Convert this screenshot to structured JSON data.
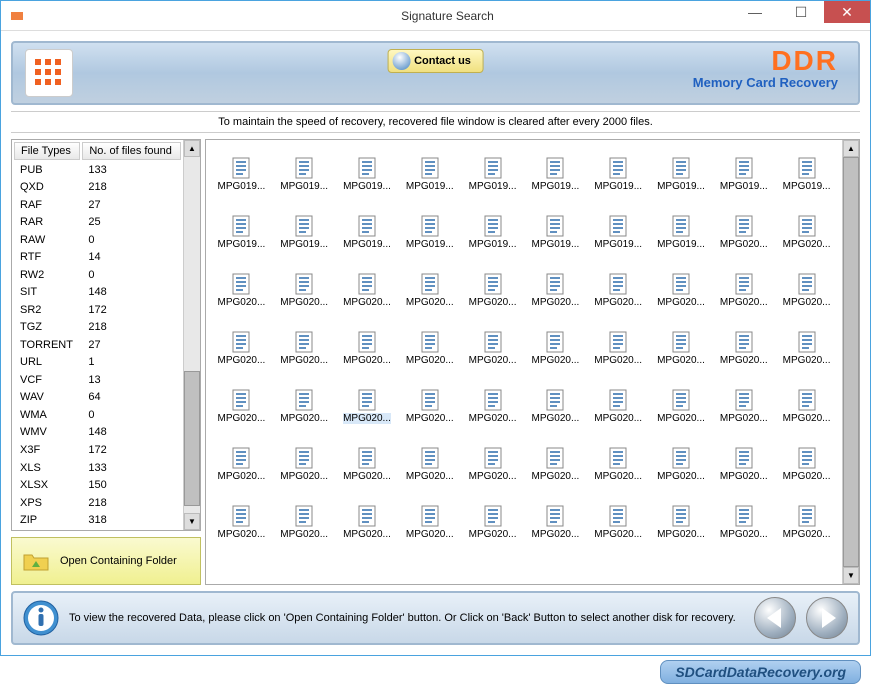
{
  "window": {
    "title": "Signature Search"
  },
  "header": {
    "contact_label": "Contact us",
    "brand_ddr": "DDR",
    "brand_sub": "Memory Card Recovery"
  },
  "info_bar": "To maintain the speed of recovery, recovered file window is cleared after every 2000 files.",
  "table": {
    "col1": "File Types",
    "col2": "No. of files found",
    "rows": [
      {
        "type": "PUB",
        "count": 133
      },
      {
        "type": "QXD",
        "count": 218
      },
      {
        "type": "RAF",
        "count": 27
      },
      {
        "type": "RAR",
        "count": 25
      },
      {
        "type": "RAW",
        "count": 0
      },
      {
        "type": "RTF",
        "count": 14
      },
      {
        "type": "RW2",
        "count": 0
      },
      {
        "type": "SIT",
        "count": 148
      },
      {
        "type": "SR2",
        "count": 172
      },
      {
        "type": "TGZ",
        "count": 218
      },
      {
        "type": "TORRENT",
        "count": 27
      },
      {
        "type": "URL",
        "count": 1
      },
      {
        "type": "VCF",
        "count": 13
      },
      {
        "type": "WAV",
        "count": 64
      },
      {
        "type": "WMA",
        "count": 0
      },
      {
        "type": "WMV",
        "count": 148
      },
      {
        "type": "X3F",
        "count": 172
      },
      {
        "type": "XLS",
        "count": 133
      },
      {
        "type": "XLSX",
        "count": 150
      },
      {
        "type": "XPS",
        "count": 218
      },
      {
        "type": "ZIP",
        "count": 318
      }
    ]
  },
  "open_folder_label": "Open Containing Folder",
  "files": {
    "row1": [
      "MPG019...",
      "MPG019...",
      "MPG019...",
      "MPG019...",
      "MPG019...",
      "MPG019...",
      "MPG019...",
      "MPG019...",
      "MPG019...",
      "MPG019..."
    ],
    "row2": [
      "MPG019...",
      "MPG019...",
      "MPG019...",
      "MPG019...",
      "MPG019...",
      "MPG019...",
      "MPG019...",
      "MPG019...",
      "MPG020...",
      "MPG020..."
    ],
    "row3": [
      "MPG020...",
      "MPG020...",
      "MPG020...",
      "MPG020...",
      "MPG020...",
      "MPG020...",
      "MPG020...",
      "MPG020...",
      "MPG020...",
      "MPG020..."
    ],
    "row4": [
      "MPG020...",
      "MPG020...",
      "MPG020...",
      "MPG020...",
      "MPG020...",
      "MPG020...",
      "MPG020...",
      "MPG020...",
      "MPG020...",
      "MPG020..."
    ],
    "row5": [
      "MPG020...",
      "MPG020...",
      "MPG020...",
      "MPG020...",
      "MPG020...",
      "MPG020...",
      "MPG020...",
      "MPG020...",
      "MPG020...",
      "MPG020..."
    ],
    "row6": [
      "MPG020...",
      "MPG020...",
      "MPG020...",
      "MPG020...",
      "MPG020...",
      "MPG020...",
      "MPG020...",
      "MPG020...",
      "MPG020...",
      "MPG020..."
    ],
    "row7": [
      "MPG020...",
      "MPG020...",
      "MPG020...",
      "MPG020...",
      "MPG020...",
      "MPG020...",
      "MPG020...",
      "MPG020...",
      "MPG020...",
      "MPG020..."
    ],
    "selected_index": 42
  },
  "footer": {
    "text": "To view the recovered Data, please click on 'Open Containing Folder' button. Or Click on 'Back' Button to select another disk for recovery."
  },
  "website": "SDCardDataRecovery.org"
}
